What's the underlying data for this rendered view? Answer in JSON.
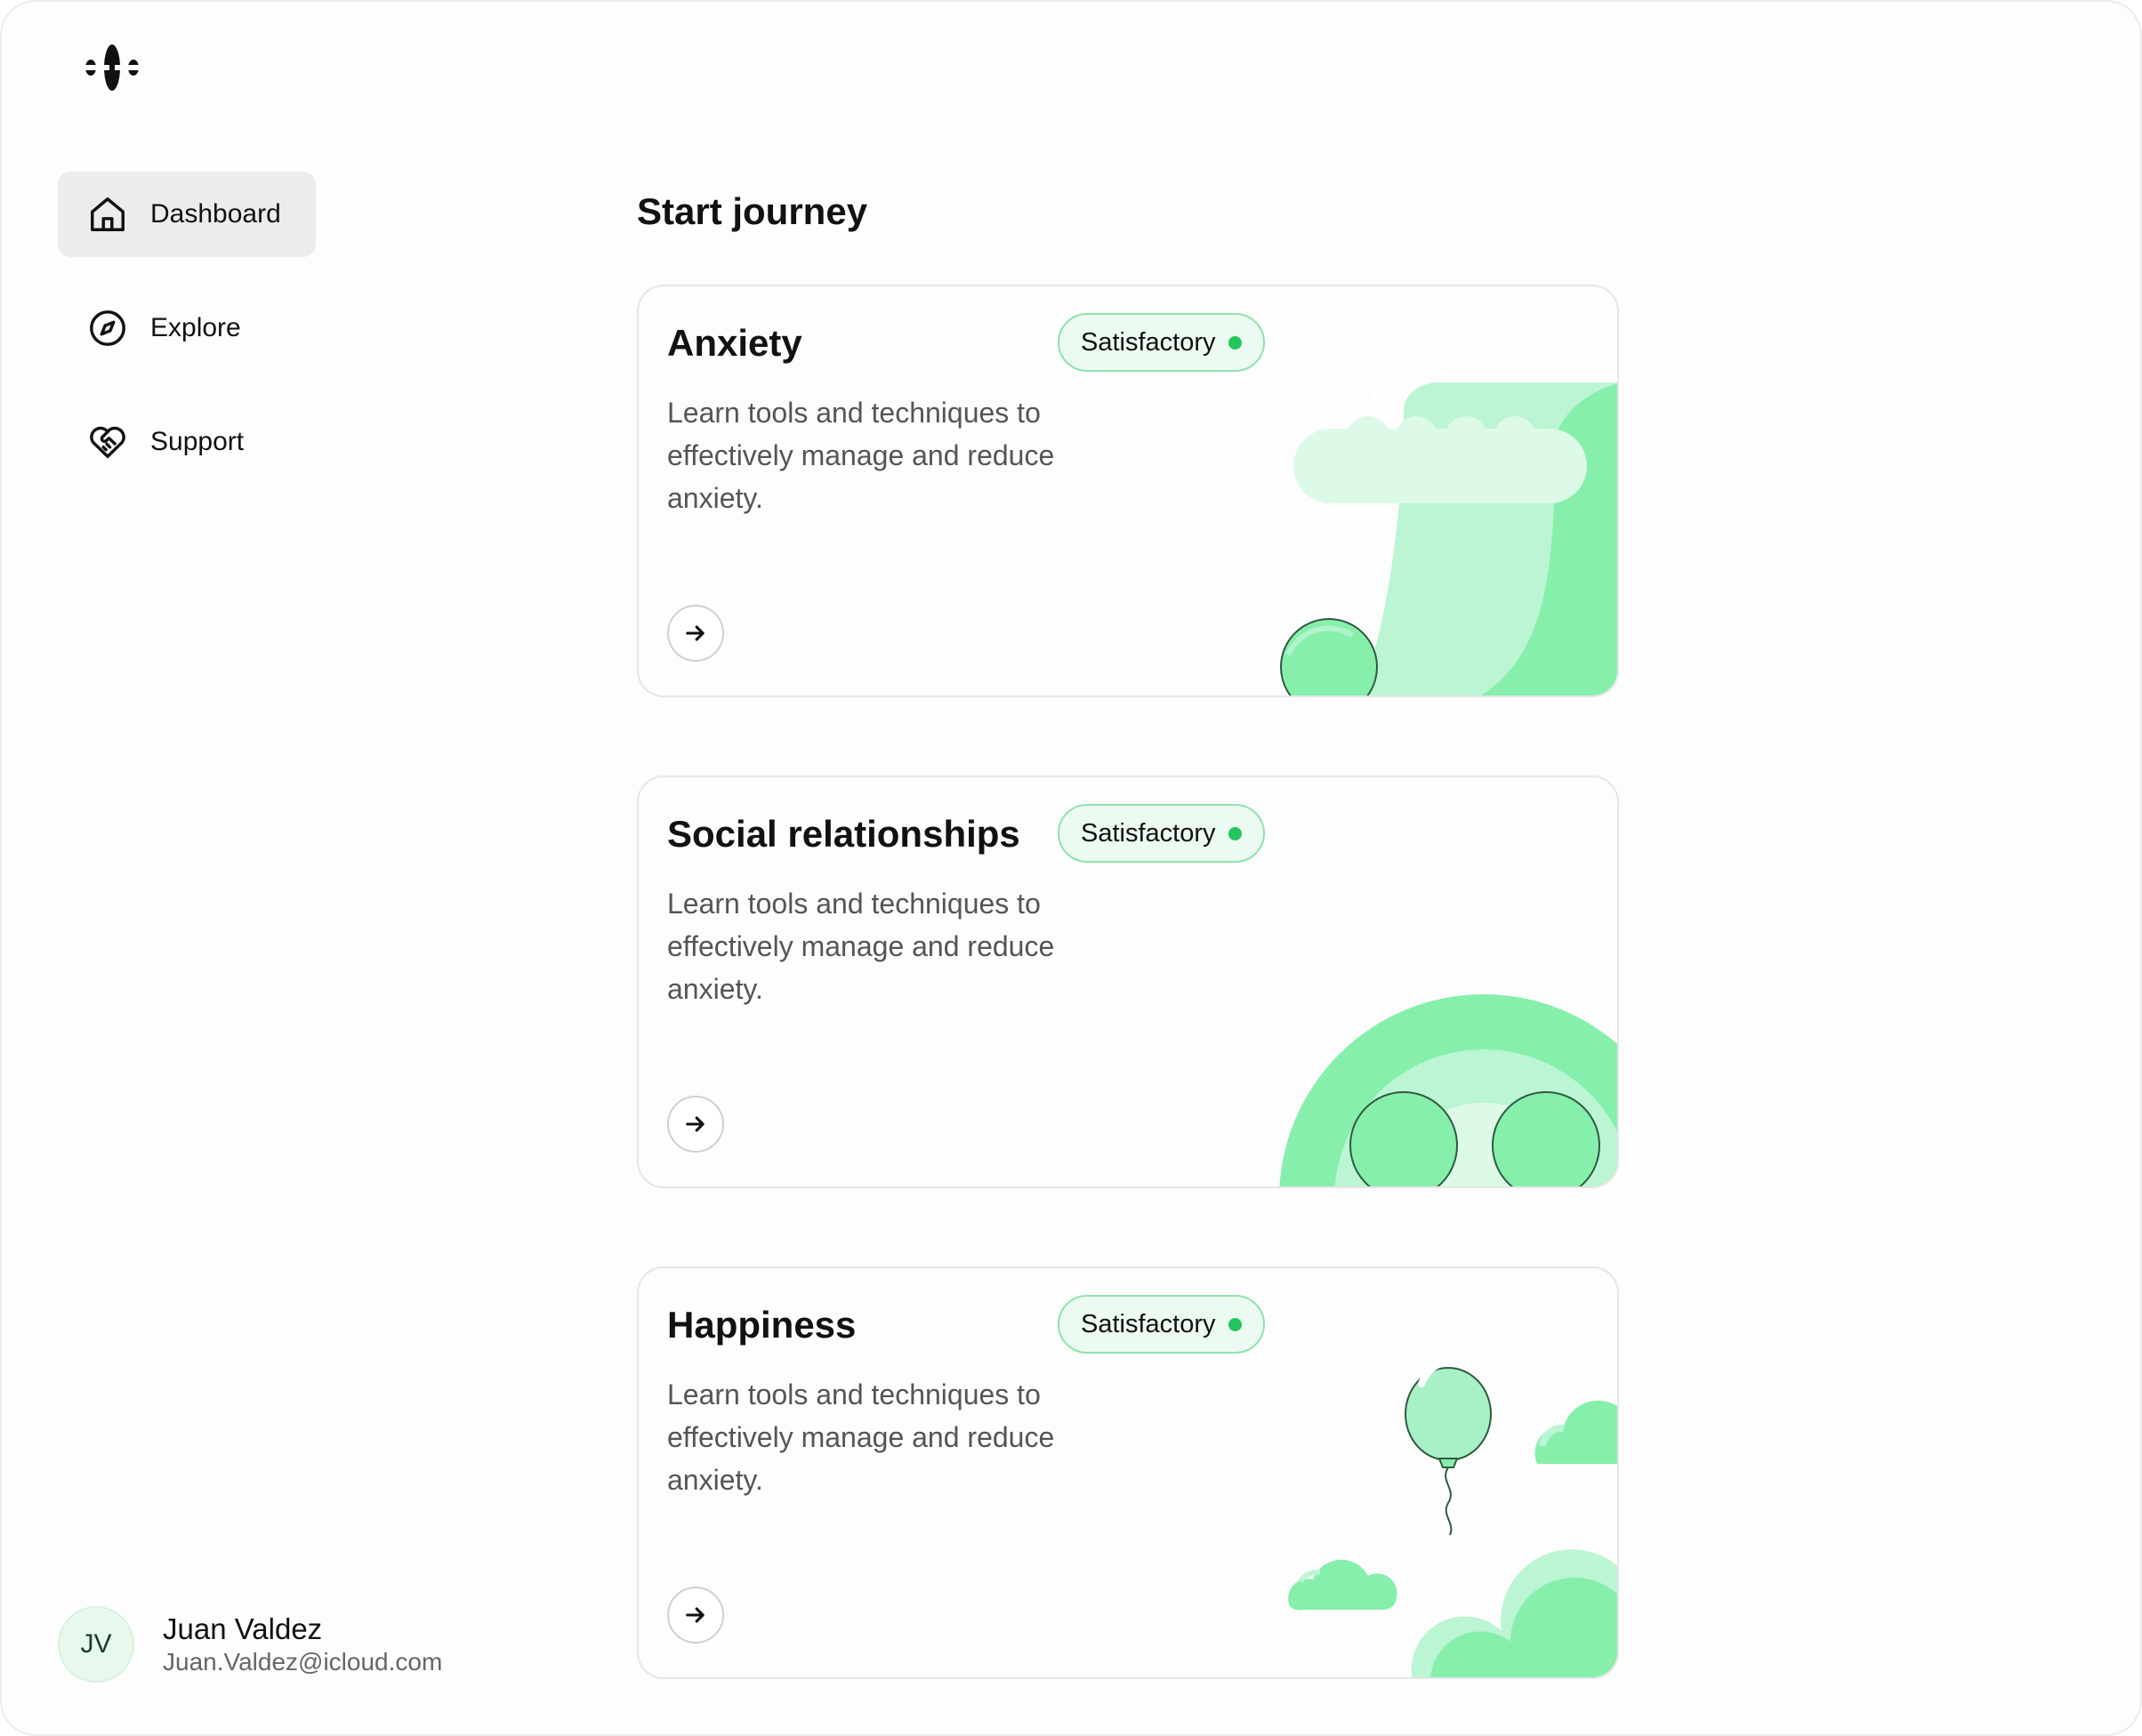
{
  "sidebar": {
    "items": [
      {
        "label": "Dashboard",
        "icon": "home-icon",
        "active": true
      },
      {
        "label": "Explore",
        "icon": "compass-icon",
        "active": false
      },
      {
        "label": "Support",
        "icon": "heart-handshake-icon",
        "active": false
      }
    ]
  },
  "user": {
    "initials": "JV",
    "name": "Juan Valdez",
    "email": "Juan.Valdez@icloud.com"
  },
  "main": {
    "heading": "Start journey",
    "cards": [
      {
        "title": "Anxiety",
        "status": "Satisfactory",
        "description": "Learn tools and techniques to effectively manage and reduce anxiety."
      },
      {
        "title": "Social relationships",
        "status": "Satisfactory",
        "description": "Learn tools and techniques to effectively manage and reduce anxiety."
      },
      {
        "title": "Happiness",
        "status": "Satisfactory",
        "description": "Learn tools and techniques to effectively manage and reduce anxiety."
      }
    ]
  },
  "colors": {
    "accent": "#22c55e",
    "green_light": "#bbf5d3",
    "green_mid": "#86efac",
    "badge_bg": "#ecfbf1",
    "nav_active_bg": "#ececec"
  }
}
